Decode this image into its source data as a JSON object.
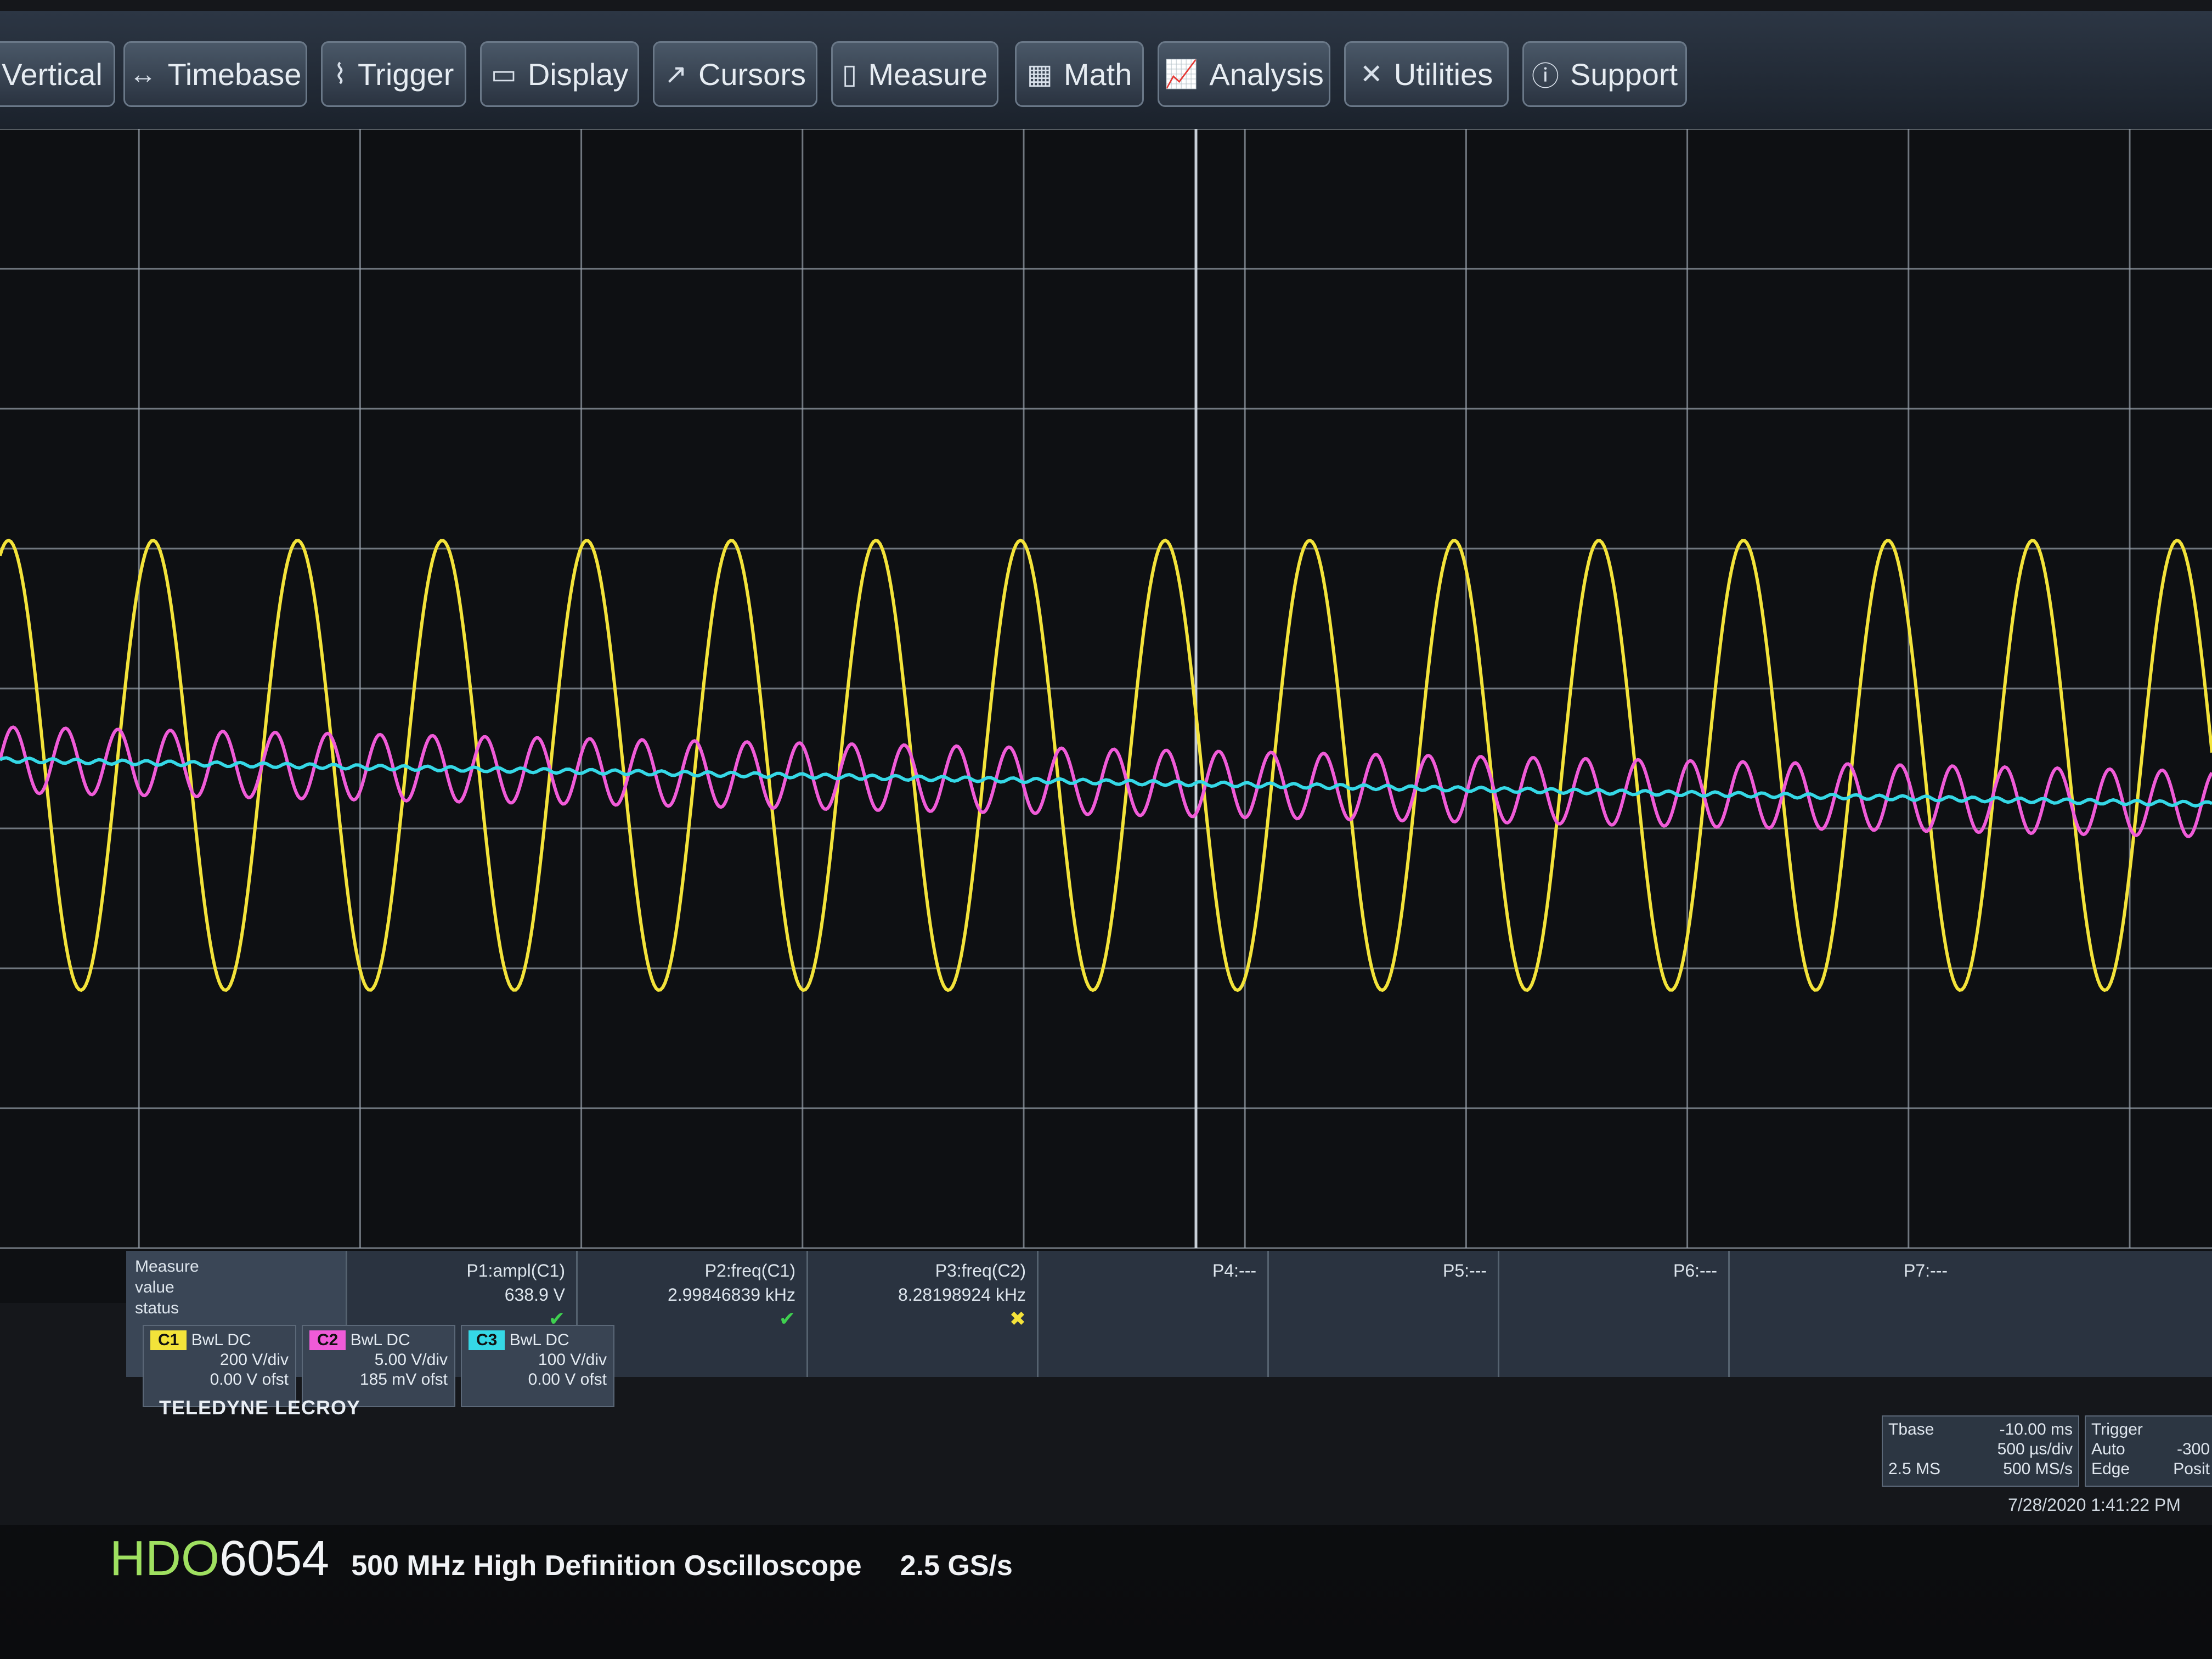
{
  "menu": [
    {
      "label": "Vertical",
      "icon": ""
    },
    {
      "label": "Timebase",
      "icon": "↔"
    },
    {
      "label": "Trigger",
      "icon": "⌇"
    },
    {
      "label": "Display",
      "icon": "▭"
    },
    {
      "label": "Cursors",
      "icon": "↗"
    },
    {
      "label": "Measure",
      "icon": "▯"
    },
    {
      "label": "Math",
      "icon": "▦"
    },
    {
      "label": "Analysis",
      "icon": "📈"
    },
    {
      "label": "Utilities",
      "icon": "✕"
    },
    {
      "label": "Support",
      "icon": "ⓘ"
    }
  ],
  "measure": {
    "head": [
      "Measure",
      "value",
      "status"
    ],
    "params": [
      {
        "name": "P1:ampl(C1)",
        "value": "638.9 V",
        "status": "ok"
      },
      {
        "name": "P2:freq(C1)",
        "value": "2.99846839 kHz",
        "status": "ok"
      },
      {
        "name": "P3:freq(C2)",
        "value": "8.28198924 kHz",
        "status": "warn"
      },
      {
        "name": "P4:---",
        "value": "",
        "status": ""
      },
      {
        "name": "P5:---",
        "value": "",
        "status": ""
      },
      {
        "name": "P6:---",
        "value": "",
        "status": ""
      },
      {
        "name": "P7:---",
        "value": "",
        "status": ""
      }
    ]
  },
  "channels": [
    {
      "tag": "C1",
      "color": "#f3e33a",
      "coupling": "BwL DC",
      "scale": "200 V/div",
      "offset": "0.00 V ofst"
    },
    {
      "tag": "C2",
      "color": "#f05bd8",
      "coupling": "BwL DC",
      "scale": "5.00 V/div",
      "offset": "185 mV ofst"
    },
    {
      "tag": "C3",
      "color": "#35d8e6",
      "coupling": "BwL DC",
      "scale": "100 V/div",
      "offset": "0.00 V ofst"
    }
  ],
  "brand": "TELEDYNE LECROY",
  "timebase": {
    "label": "Tbase",
    "delay": "-10.00 ms",
    "scale": "500 µs/div",
    "samples": "2.5 MS",
    "rate": "500 MS/s"
  },
  "trigger": {
    "label": "Trigger",
    "mode": "Auto",
    "type": "Edge",
    "level": "-300",
    "position": "Posit"
  },
  "datetime": "7/28/2020 1:41:22 PM",
  "label": {
    "model_a": "HDO",
    "model_b": "6054",
    "desc": "500 MHz High Definition Oscilloscope",
    "rate": "2.5 GS/s"
  },
  "colors": {
    "c1": "#f3e33a",
    "c2": "#f05bd8",
    "c3": "#35d8e6"
  }
}
